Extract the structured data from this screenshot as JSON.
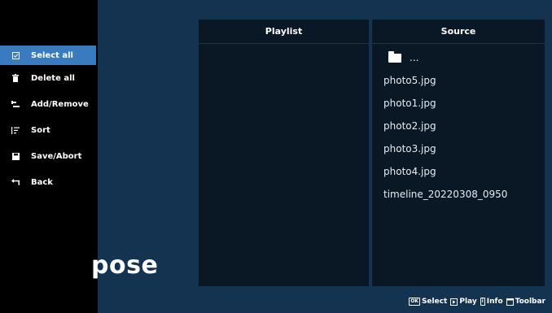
{
  "background_color": "#143350",
  "accent_color": "#3a7bbf",
  "sidebar": {
    "items": [
      {
        "label": "Select all",
        "icon": "checkbox-icon",
        "selected": true
      },
      {
        "label": "Delete all",
        "icon": "trash-icon",
        "selected": false
      },
      {
        "label": "Add/Remove",
        "icon": "add-remove-icon",
        "selected": false
      },
      {
        "label": "Sort",
        "icon": "sort-icon",
        "selected": false
      },
      {
        "label": "Save/Abort",
        "icon": "save-icon",
        "selected": false
      },
      {
        "label": "Back",
        "icon": "back-icon",
        "selected": false
      }
    ]
  },
  "background_title": "pose",
  "playlist": {
    "header": "Playlist",
    "items": []
  },
  "source": {
    "header": "Source",
    "folder_label": "...",
    "items": [
      "photo5.jpg",
      "photo1.jpg",
      "photo2.jpg",
      "photo3.jpg",
      "photo4.jpg",
      "timeline_20220308_0950"
    ]
  },
  "footer": {
    "select_key": "OK",
    "select_label": "Select",
    "play_label": "Play",
    "info_key": "i",
    "info_label": "Info",
    "toolbar_label": "Toolbar"
  }
}
